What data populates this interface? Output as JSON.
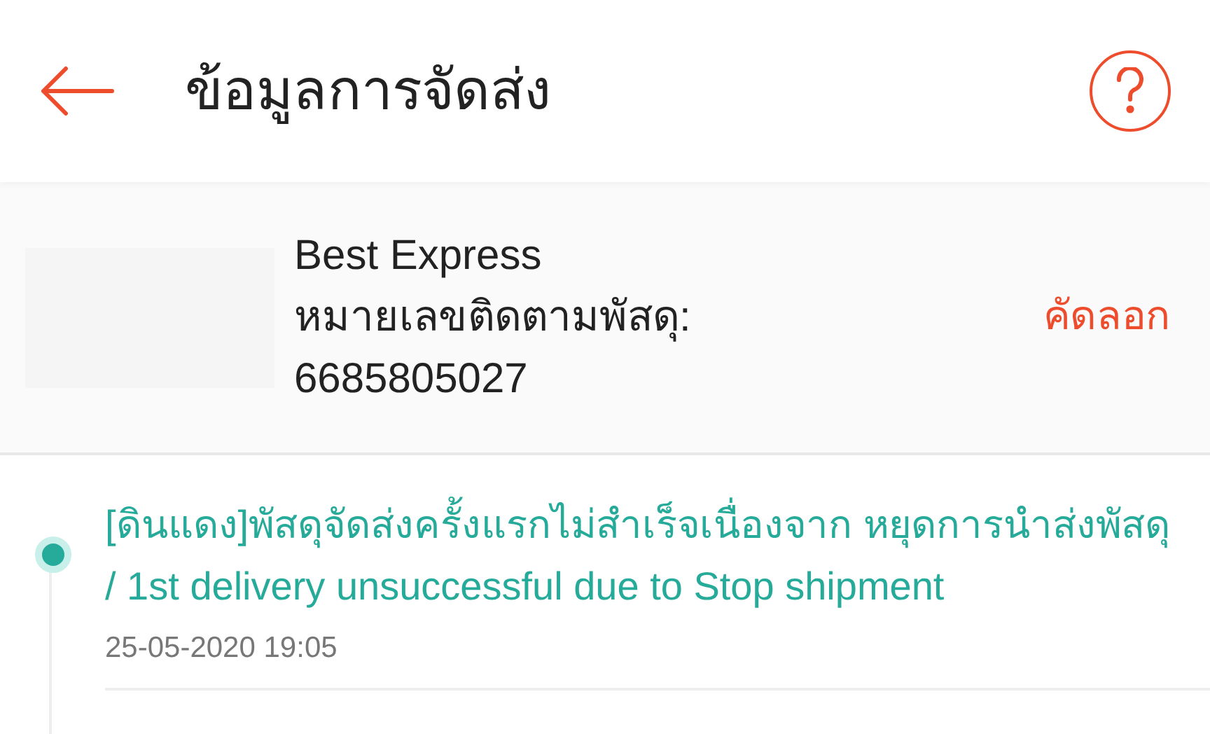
{
  "header": {
    "title": "ข้อมูลการจัดส่ง"
  },
  "shipment": {
    "carrier": "Best Express",
    "tracking_label": "หมายเลขติดตามพัสดุ:",
    "tracking_number": "6685805027",
    "copy_button": "คัดลอก"
  },
  "events": [
    {
      "text": "[ดินแดง]พัสดุจัดส่งครั้งแรกไม่สำเร็จเนื่องจาก หยุดการนำส่งพัสดุ / 1st delivery unsuccessful due to Stop shipment",
      "time": "25-05-2020 19:05",
      "latest": true
    }
  ]
}
